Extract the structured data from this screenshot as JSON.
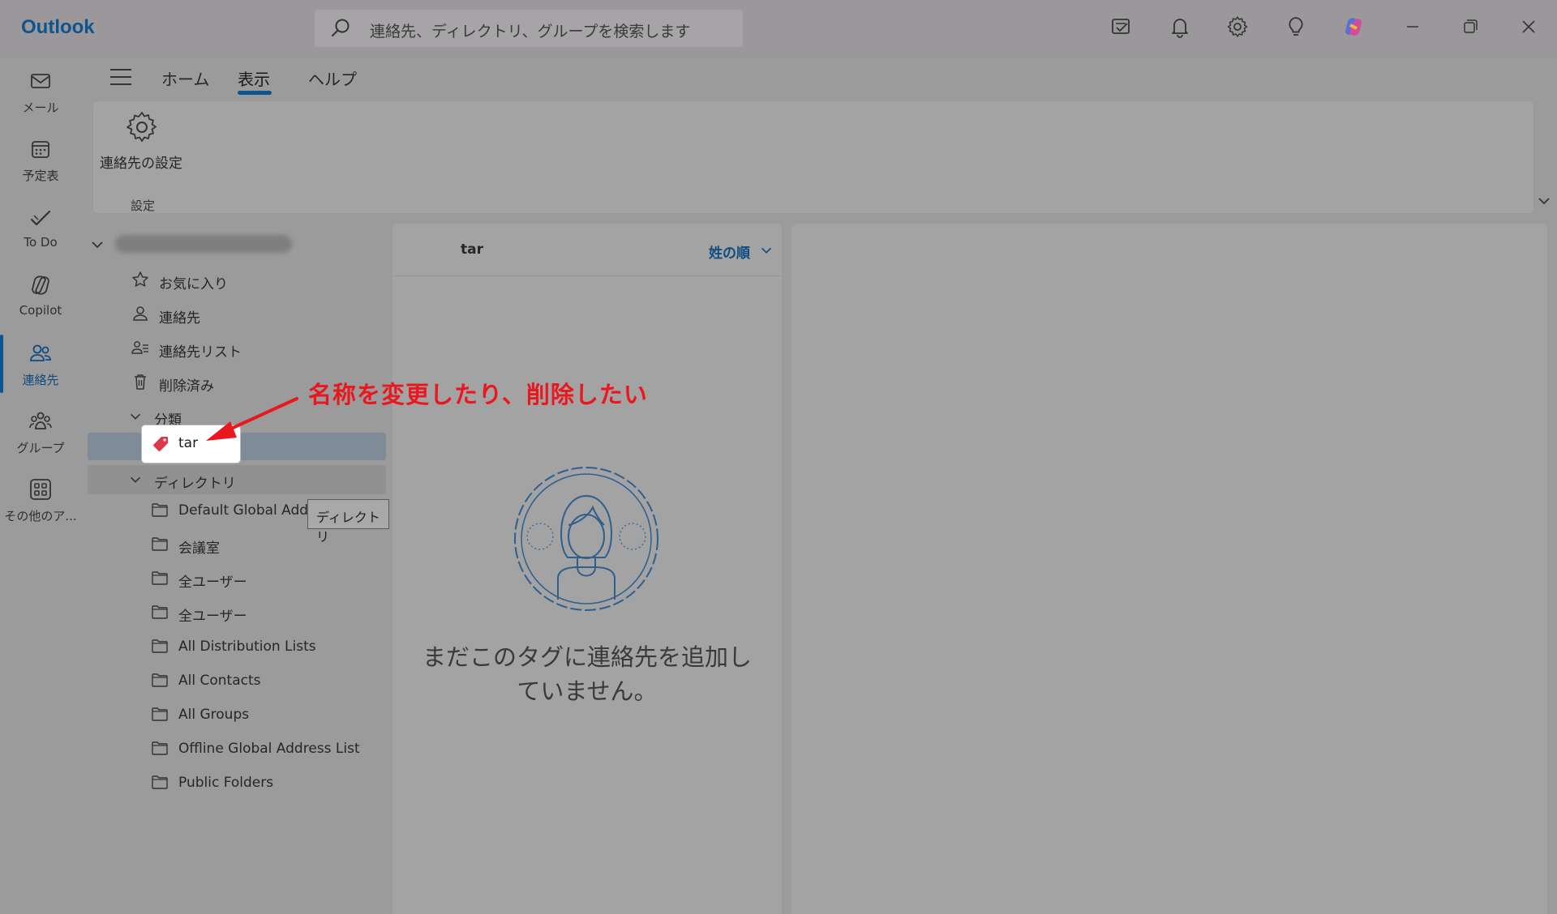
{
  "app": {
    "name": "Outlook"
  },
  "search": {
    "placeholder": "連絡先、ディレクトリ、グループを検索します"
  },
  "rail": {
    "items": [
      {
        "label": "メール",
        "icon": "mail-icon"
      },
      {
        "label": "予定表",
        "icon": "calendar-icon"
      },
      {
        "label": "To Do",
        "icon": "todo-icon"
      },
      {
        "label": "Copilot",
        "icon": "copilot-icon"
      },
      {
        "label": "連絡先",
        "icon": "people-icon",
        "active": true
      },
      {
        "label": "グループ",
        "icon": "groups-icon"
      },
      {
        "label": "その他のア...",
        "icon": "apps-icon"
      }
    ]
  },
  "ribbon": {
    "tabs": [
      {
        "label": "ホーム"
      },
      {
        "label": "表示",
        "active": true
      },
      {
        "label": "ヘルプ"
      }
    ],
    "contact_settings_label": "連絡先の設定",
    "group_label": "設定"
  },
  "folders": {
    "favorites": "お気に入り",
    "contacts": "連絡先",
    "contact_lists": "連絡先リスト",
    "deleted": "削除済み",
    "categories_header": "分類",
    "category_tag": "tar",
    "directory_header": "ディレクトリ",
    "directory_items": [
      "Default Global Addr",
      "会議室",
      "全ユーザー",
      "全ユーザー",
      "All Distribution Lists",
      "All Contacts",
      "All Groups",
      "Offline Global Address List",
      "Public Folders"
    ]
  },
  "tooltip": {
    "text": "ディレクトリ"
  },
  "list": {
    "title": "tar",
    "sort_label": "姓の順",
    "empty_message": "まだこのタグに連絡先を追加していません。"
  },
  "annotation": {
    "text": "名称を変更したり、削除したい",
    "color": "#e8181e"
  },
  "colors": {
    "accent": "#0f548c",
    "tag": "#e0364a"
  }
}
